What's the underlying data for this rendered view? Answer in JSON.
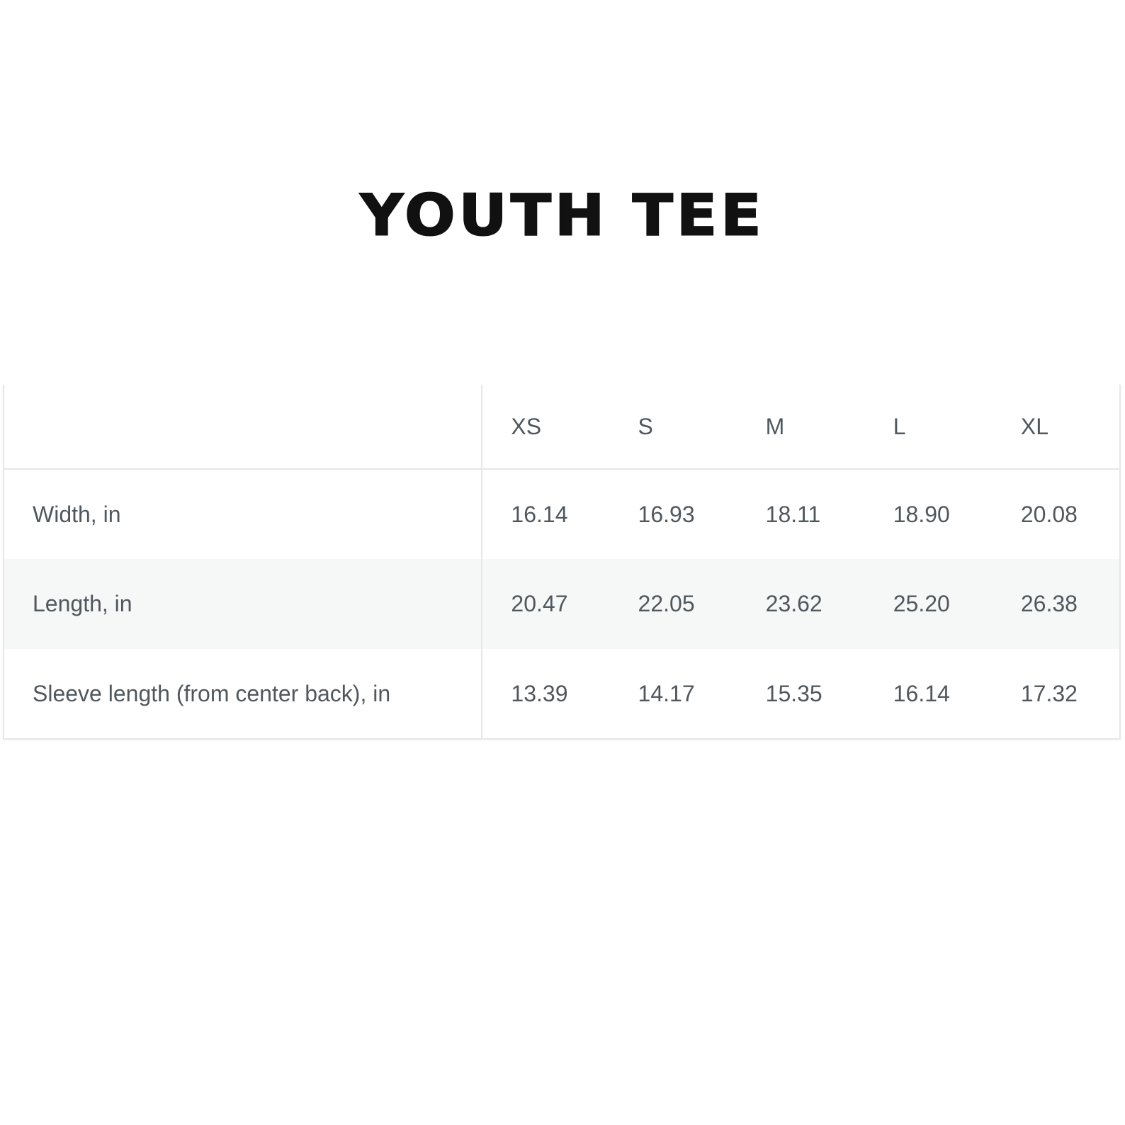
{
  "title": "YOUTH TEE",
  "table": {
    "corner": "",
    "sizes": [
      "XS",
      "S",
      "M",
      "L",
      "XL"
    ],
    "rows": [
      {
        "label": "Width, in",
        "values": [
          "16.14",
          "16.93",
          "18.11",
          "18.90",
          "20.08"
        ]
      },
      {
        "label": "Length, in",
        "values": [
          "20.47",
          "22.05",
          "23.62",
          "25.20",
          "26.38"
        ]
      },
      {
        "label": "Sleeve length (from center back), in",
        "values": [
          "13.39",
          "14.17",
          "15.35",
          "16.14",
          "17.32"
        ]
      }
    ]
  },
  "colors": {
    "text": "#50585e",
    "border": "#e6e7e7",
    "shaded_row": "#f6f7f7",
    "title": "#111111"
  }
}
